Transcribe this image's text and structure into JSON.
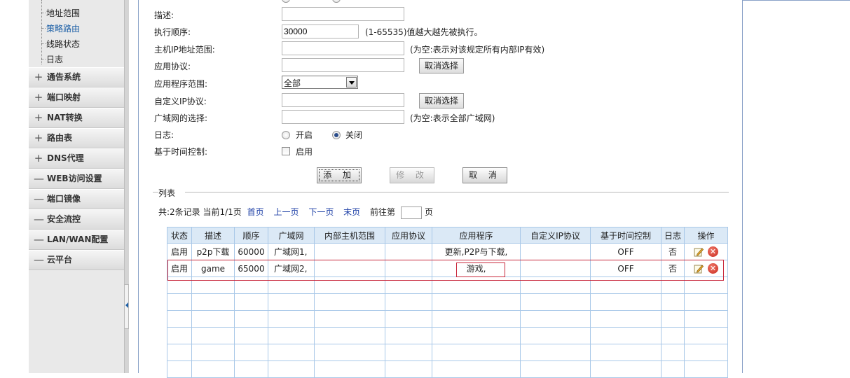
{
  "sidebar": {
    "tree_items": [
      {
        "label": "地址范围",
        "active": false
      },
      {
        "label": "策略路由",
        "active": true
      },
      {
        "label": "线路状态",
        "active": false
      },
      {
        "label": "日志",
        "active": false
      }
    ],
    "menus": [
      {
        "sign": "+",
        "label": "通告系统"
      },
      {
        "sign": "+",
        "label": "端口映射"
      },
      {
        "sign": "+",
        "label": "NAT转换"
      },
      {
        "sign": "+",
        "label": "路由表"
      },
      {
        "sign": "+",
        "label": "DNS代理"
      },
      {
        "sign": "—",
        "label": "WEB访问设置"
      },
      {
        "sign": "—",
        "label": "端口镜像"
      },
      {
        "sign": "—",
        "label": "安全流控"
      },
      {
        "sign": "—",
        "label": "LAN/WAN配置"
      },
      {
        "sign": "—",
        "label": "云平台"
      }
    ]
  },
  "form": {
    "description": {
      "label": "描述:",
      "value": ""
    },
    "order": {
      "label": "执行顺序:",
      "value": "30000",
      "hint": "(1-65535)值越大越先被执行。"
    },
    "host_ip": {
      "label": "主机IP地址范围:",
      "value": "",
      "hint": "(为空:表示对该规定所有内部IP有效)"
    },
    "app_protocol": {
      "label": "应用协议:",
      "value": "",
      "button": "取消选择"
    },
    "app_scope": {
      "label": "应用程序范围:",
      "selected": "全部"
    },
    "custom_ip": {
      "label": "自定义IP协议:",
      "value": "",
      "button": "取消选择"
    },
    "wan": {
      "label": "广域网的选择:",
      "value": "",
      "hint": "(为空:表示全部广域网)"
    },
    "log": {
      "label": "日志:",
      "on_label": "开启",
      "off_label": "关闭",
      "selected": "off"
    },
    "time_control": {
      "label": "基于时间控制:",
      "checkbox_label": "启用"
    }
  },
  "actions": {
    "add": "添 加",
    "modify": "修 改",
    "cancel": "取 消"
  },
  "list": {
    "legend": "列表",
    "pager": {
      "summary": "共:2条记录 当前1/1页",
      "first": "首页",
      "prev": "上一页",
      "next": "下一页",
      "last": "末页",
      "goto_prefix": "前往第",
      "goto_suffix": "页"
    },
    "columns": [
      "状态",
      "描述",
      "顺序",
      "广域网",
      "内部主机范围",
      "应用协议",
      "应用程序",
      "自定义IP协议",
      "基于时间控制",
      "日志",
      "操作"
    ],
    "rows": [
      [
        "启用",
        "p2p下载",
        "60000",
        "广域网1,",
        "",
        "",
        "更新,P2P与下载,",
        "",
        "OFF",
        "否"
      ],
      [
        "启用",
        "game",
        "65000",
        "广域网2,",
        "",
        "",
        "游戏,",
        "",
        "OFF",
        "否"
      ]
    ],
    "empty_rows": 6
  },
  "colors": {
    "highlight": "#c8283c",
    "link": "#1c3fa6",
    "header_bg": "#dbe9f6"
  }
}
